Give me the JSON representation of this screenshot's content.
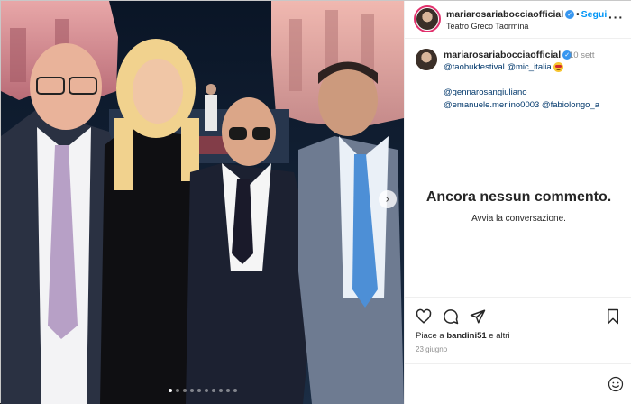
{
  "post": {
    "username": "mariarosariabocciaofficial",
    "follow_label": "Segui",
    "separator": "•",
    "location": "Teatro Greco Taormina",
    "verified": true
  },
  "caption": {
    "username": "mariarosariabocciaofficial",
    "time": "10 sett",
    "line1_mentions": "@taobukfestival @mic_italia",
    "line2": "@gennarosangiuliano",
    "line3": "@emanuele.merlino0003 @fabiolongo_a"
  },
  "comments": {
    "empty_title": "Ancora nessun commento.",
    "empty_subtitle": "Avvia la conversazione."
  },
  "engagement": {
    "likes_prefix": "Piace a ",
    "likes_user": "bandini51",
    "likes_suffix": " e altri",
    "date": "23 giugno"
  },
  "carousel": {
    "slide_count": 10,
    "active_index": 0
  },
  "icons": {
    "more": "more-icon",
    "like": "heart-icon",
    "comment": "comment-icon",
    "share": "share-icon",
    "save": "bookmark-icon",
    "emoji": "smile-icon",
    "next": "chevron-right-icon"
  },
  "colors": {
    "link": "#00376b",
    "follow": "#0095f6",
    "verified": "#3897f0",
    "muted": "#8e8e8e"
  }
}
